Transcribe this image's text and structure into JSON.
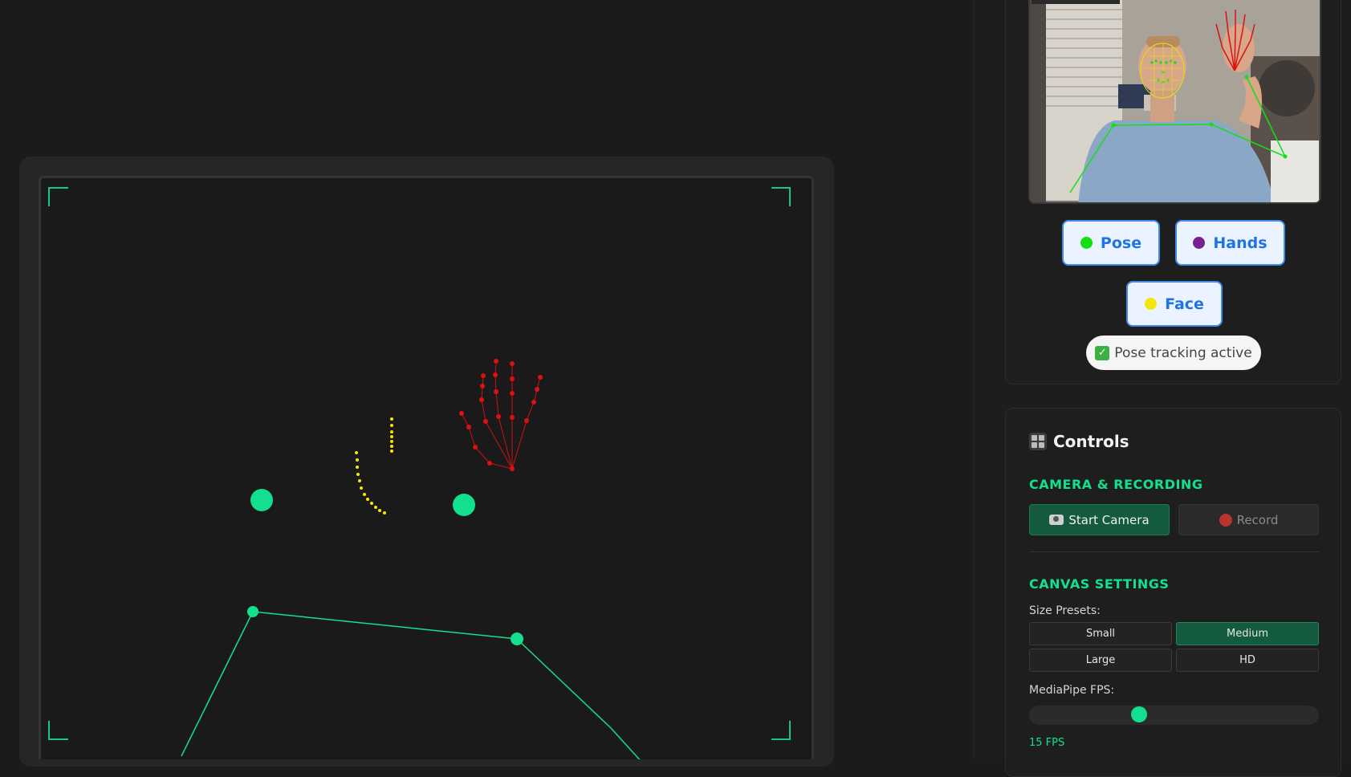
{
  "tracking_toggles": {
    "pose": {
      "label": "Pose",
      "color": "#12e012"
    },
    "hands": {
      "label": "Hands",
      "color": "#7a1f8f"
    },
    "face": {
      "label": "Face",
      "color": "#f5e60a"
    }
  },
  "status": {
    "text": "Pose tracking active"
  },
  "controls": {
    "title": "Controls",
    "camera_section": {
      "title": "CAMERA & RECORDING",
      "start_camera_label": "Start Camera",
      "record_label": "Record"
    },
    "canvas_section": {
      "title": "CANVAS SETTINGS",
      "size_presets_label": "Size Presets:",
      "presets": [
        "Small",
        "Medium",
        "Large",
        "HD"
      ],
      "active_preset": "Medium",
      "fps_label": "MediaPipe FPS:",
      "fps_value": "15 FPS",
      "fps_fraction": 0.38
    }
  },
  "colors": {
    "accent": "#12e08e",
    "pose": "#12e08e",
    "hand": "#e01010",
    "face": "#f5e60a"
  }
}
